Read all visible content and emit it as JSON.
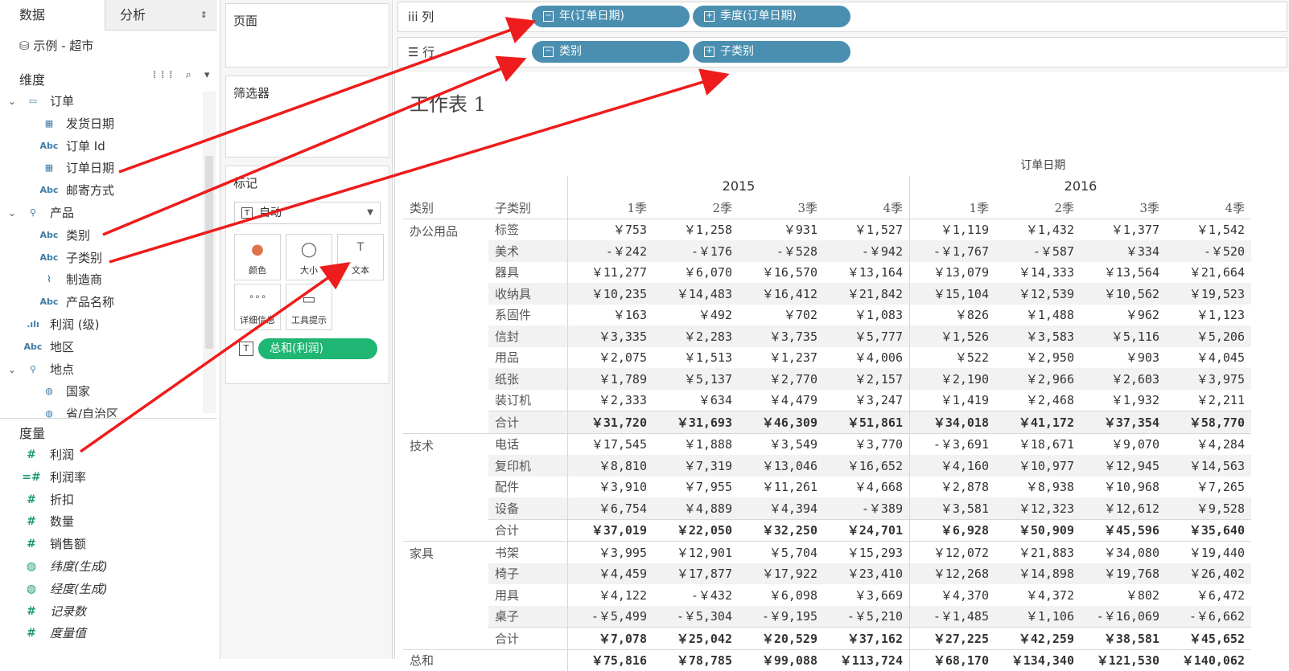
{
  "tabs": {
    "data": "数据",
    "analysis": "分析"
  },
  "datasource": "示例 - 超市",
  "dimensions": {
    "title": "维度",
    "tools": "⁞⁞⁞ ⌕ ▾",
    "items": [
      {
        "label": "订单",
        "icon": "folder-icon",
        "level": 0,
        "chev": "⌄"
      },
      {
        "label": "发货日期",
        "icon": "calendar-icon",
        "level": 1
      },
      {
        "label": "订单 Id",
        "icon": "abc-icon",
        "level": 1
      },
      {
        "label": "订单日期",
        "icon": "calendar-icon",
        "level": 1
      },
      {
        "label": "邮寄方式",
        "icon": "abc-icon",
        "level": 1
      },
      {
        "label": "产品",
        "icon": "hierarchy-icon",
        "level": 0,
        "chev": "⌄"
      },
      {
        "label": "类别",
        "icon": "abc-icon",
        "level": 1
      },
      {
        "label": "子类别",
        "icon": "abc-icon",
        "level": 1
      },
      {
        "label": "制造商",
        "icon": "paperclip-icon",
        "level": 1
      },
      {
        "label": "产品名称",
        "icon": "abc-icon",
        "level": 1
      },
      {
        "label": "利润 (级)",
        "icon": "bin-icon",
        "level": 0.5
      },
      {
        "label": "地区",
        "icon": "abc-icon",
        "level": 0
      },
      {
        "label": "地点",
        "icon": "hierarchy-icon",
        "level": 0,
        "chev": "⌄"
      },
      {
        "label": "国家",
        "icon": "globe-icon",
        "level": 1
      },
      {
        "label": "省/自治区",
        "icon": "globe-icon",
        "level": 1
      }
    ]
  },
  "measures": {
    "title": "度量",
    "items": [
      {
        "label": "利润",
        "icon": "#",
        "ital": false
      },
      {
        "label": "利润率",
        "icon": "=#",
        "ital": false
      },
      {
        "label": "折扣",
        "icon": "#",
        "ital": false
      },
      {
        "label": "数量",
        "icon": "#",
        "ital": false
      },
      {
        "label": "销售额",
        "icon": "#",
        "ital": false
      },
      {
        "label": "纬度(生成)",
        "icon": "globe",
        "ital": true
      },
      {
        "label": "经度(生成)",
        "icon": "globe",
        "ital": true
      },
      {
        "label": "记录数",
        "icon": "#",
        "ital": true
      },
      {
        "label": "度量值",
        "icon": "#",
        "ital": true
      }
    ]
  },
  "cards": {
    "pages": "页面",
    "filters": "筛选器",
    "marks": "标记",
    "mark_type": "自动",
    "buttons": [
      {
        "label": "颜色",
        "glyph": "●"
      },
      {
        "label": "大小",
        "glyph": "◯"
      },
      {
        "label": "文本",
        "glyph": "T"
      },
      {
        "label": "详细信息",
        "glyph": "∘∘∘"
      },
      {
        "label": "工具提示",
        "glyph": "▭"
      }
    ],
    "text_pill": "总和(利润)"
  },
  "shelves": {
    "columns_label": "iii  列",
    "rows_label": "☰  行",
    "column_pills": [
      "年(订单日期)",
      "季度(订单日期)"
    ],
    "row_pills": [
      "类别",
      "子类别"
    ]
  },
  "view": {
    "sheet_title": "工作表 1",
    "col_header": "订单日期",
    "years": [
      "2015",
      "2016"
    ],
    "row_headers": [
      "类别",
      "子类别"
    ],
    "quarters": [
      "1季",
      "2季",
      "3季",
      "4季",
      "1季",
      "2季",
      "3季",
      "4季"
    ],
    "groups": [
      {
        "category": "办公用品",
        "rows": [
          [
            "标签",
            "￥753",
            "￥1,258",
            "￥931",
            "￥1,527",
            "￥1,119",
            "￥1,432",
            "￥1,377",
            "￥1,542"
          ],
          [
            "美术",
            "-￥242",
            "-￥176",
            "-￥528",
            "-￥942",
            "-￥1,767",
            "-￥587",
            "￥334",
            "-￥520"
          ],
          [
            "器具",
            "￥11,277",
            "￥6,070",
            "￥16,570",
            "￥13,164",
            "￥13,079",
            "￥14,333",
            "￥13,564",
            "￥21,664"
          ],
          [
            "收纳具",
            "￥10,235",
            "￥14,483",
            "￥16,412",
            "￥21,842",
            "￥15,104",
            "￥12,539",
            "￥10,562",
            "￥19,523"
          ],
          [
            "系固件",
            "￥163",
            "￥492",
            "￥702",
            "￥1,083",
            "￥826",
            "￥1,488",
            "￥962",
            "￥1,123"
          ],
          [
            "信封",
            "￥3,335",
            "￥2,283",
            "￥3,735",
            "￥5,777",
            "￥1,526",
            "￥3,583",
            "￥5,116",
            "￥5,206"
          ],
          [
            "用品",
            "￥2,075",
            "￥1,513",
            "￥1,237",
            "￥4,006",
            "￥522",
            "￥2,950",
            "￥903",
            "￥4,045"
          ],
          [
            "纸张",
            "￥1,789",
            "￥5,137",
            "￥2,770",
            "￥2,157",
            "￥2,190",
            "￥2,966",
            "￥2,603",
            "￥3,975"
          ],
          [
            "装订机",
            "￥2,333",
            "￥634",
            "￥4,479",
            "￥3,247",
            "￥1,419",
            "￥2,468",
            "￥1,932",
            "￥2,211"
          ]
        ],
        "total": [
          "合计",
          "￥31,720",
          "￥31,693",
          "￥46,309",
          "￥51,861",
          "￥34,018",
          "￥41,172",
          "￥37,354",
          "￥58,770"
        ]
      },
      {
        "category": "技术",
        "rows": [
          [
            "电话",
            "￥17,545",
            "￥1,888",
            "￥3,549",
            "￥3,770",
            "-￥3,691",
            "￥18,671",
            "￥9,070",
            "￥4,284"
          ],
          [
            "复印机",
            "￥8,810",
            "￥7,319",
            "￥13,046",
            "￥16,652",
            "￥4,160",
            "￥10,977",
            "￥12,945",
            "￥14,563"
          ],
          [
            "配件",
            "￥3,910",
            "￥7,955",
            "￥11,261",
            "￥4,668",
            "￥2,878",
            "￥8,938",
            "￥10,968",
            "￥7,265"
          ],
          [
            "设备",
            "￥6,754",
            "￥4,889",
            "￥4,394",
            "-￥389",
            "￥3,581",
            "￥12,323",
            "￥12,612",
            "￥9,528"
          ]
        ],
        "total": [
          "合计",
          "￥37,019",
          "￥22,050",
          "￥32,250",
          "￥24,701",
          "￥6,928",
          "￥50,909",
          "￥45,596",
          "￥35,640"
        ]
      },
      {
        "category": "家具",
        "rows": [
          [
            "书架",
            "￥3,995",
            "￥12,901",
            "￥5,704",
            "￥15,293",
            "￥12,072",
            "￥21,883",
            "￥34,080",
            "￥19,440"
          ],
          [
            "椅子",
            "￥4,459",
            "￥17,877",
            "￥17,922",
            "￥23,410",
            "￥12,268",
            "￥14,898",
            "￥19,768",
            "￥26,402"
          ],
          [
            "用具",
            "￥4,122",
            "-￥432",
            "￥6,098",
            "￥3,669",
            "￥4,370",
            "￥4,372",
            "￥802",
            "￥6,472"
          ],
          [
            "桌子",
            "-￥5,499",
            "-￥5,304",
            "-￥9,195",
            "-￥5,210",
            "-￥1,485",
            "￥1,106",
            "-￥16,069",
            "-￥6,662"
          ]
        ],
        "total": [
          "合计",
          "￥7,078",
          "￥25,042",
          "￥20,529",
          "￥37,162",
          "￥27,225",
          "￥42,259",
          "￥38,581",
          "￥45,652"
        ]
      }
    ],
    "grand_total": [
      "总和",
      "￥75,816",
      "￥78,785",
      "￥99,088",
      "￥113,724",
      "￥68,170",
      "￥134,340",
      "￥121,530",
      "￥140,062"
    ]
  },
  "colors": {
    "pill_blue": "#4a8fb0",
    "pill_green": "#1fb573",
    "arrow_red": "#ee1c1c"
  }
}
